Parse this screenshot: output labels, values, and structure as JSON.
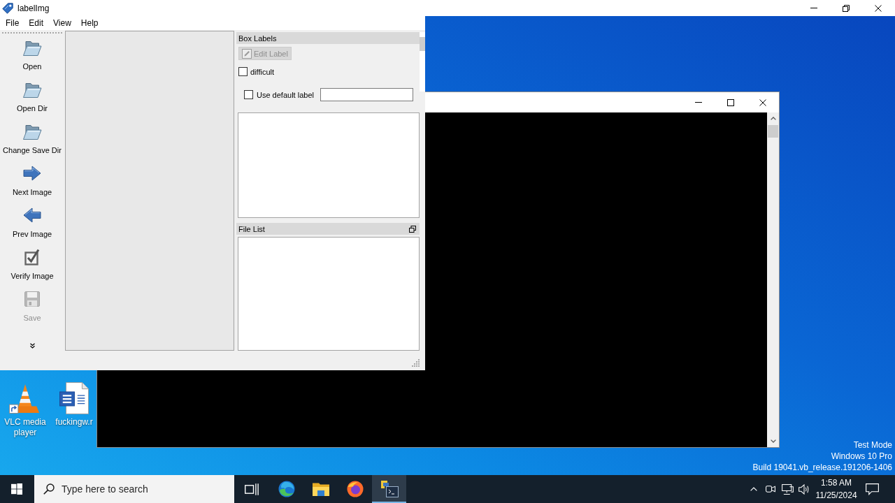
{
  "window": {
    "title": "labelImg"
  },
  "menu": [
    "File",
    "Edit",
    "View",
    "Help"
  ],
  "toolbar": [
    {
      "label": "Open",
      "disabled": false
    },
    {
      "label": "Open Dir",
      "disabled": false
    },
    {
      "label": "Change Save Dir",
      "disabled": false
    },
    {
      "label": "Next Image",
      "disabled": false
    },
    {
      "label": "Prev Image",
      "disabled": false
    },
    {
      "label": "Verify Image",
      "disabled": false
    },
    {
      "label": "Save",
      "disabled": true
    }
  ],
  "box_labels": {
    "title": "Box Labels",
    "edit_button": {
      "label": "Edit Label",
      "disabled": true
    },
    "difficult": {
      "label": "difficult",
      "checked": false
    },
    "use_default_label": {
      "label": "Use default label",
      "checked": false
    }
  },
  "file_list": {
    "title": "File List"
  },
  "desktop": {
    "icons": [
      {
        "label": "VLC media player"
      },
      {
        "label": "fuckingw.r"
      }
    ],
    "notice": [
      "Test Mode",
      "Windows 10 Pro",
      "Build 19041.vb_release.191206-1406"
    ]
  },
  "taskbar": {
    "search": {
      "placeholder": "Type here to search"
    },
    "apps": [
      {
        "active": false
      },
      {
        "active": false
      },
      {
        "active": false
      },
      {
        "active": true
      }
    ],
    "clock": {
      "time": "1:58 AM",
      "date": "11/25/2024"
    }
  }
}
